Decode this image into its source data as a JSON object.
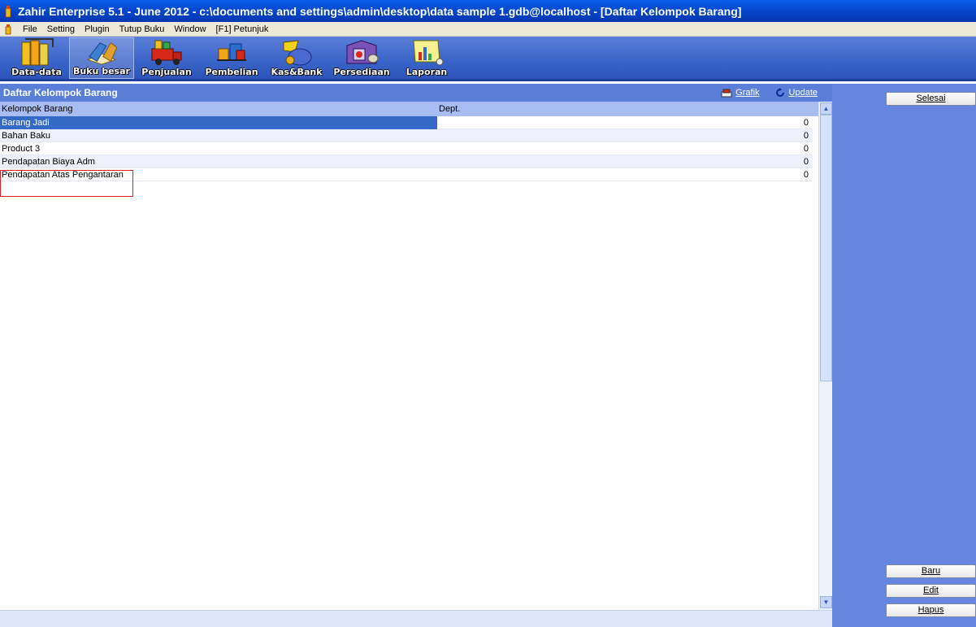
{
  "window": {
    "title": "Zahir Enterprise 5.1 - June 2012 - c:\\documents and settings\\admin\\desktop\\data sample 1.gdb@localhost - [Daftar Kelompok Barang]"
  },
  "menu": [
    "File",
    "Setting",
    "Plugin",
    "Tutup Buku",
    "Window",
    "[F1] Petunjuk"
  ],
  "toolbar": [
    {
      "label": "Data-data",
      "icon": "binders-icon"
    },
    {
      "label": "Buku besar",
      "icon": "ledger-book-icon",
      "active": true
    },
    {
      "label": "Penjualan",
      "icon": "sales-truck-icon"
    },
    {
      "label": "Pembelian",
      "icon": "purchase-gifts-icon"
    },
    {
      "label": "Kas&Bank",
      "icon": "cash-bag-icon"
    },
    {
      "label": "Persediaan",
      "icon": "warehouse-icon"
    },
    {
      "label": "Laporan",
      "icon": "report-chart-icon"
    }
  ],
  "content": {
    "title": "Daftar Kelompok Barang",
    "actions": {
      "grafik": "Grafik",
      "update": "Update"
    },
    "columns": {
      "kelompok": "Kelompok Barang",
      "dept": "Dept."
    },
    "rows": [
      {
        "kelompok": "Barang Jadi",
        "dept": "0",
        "selected": true
      },
      {
        "kelompok": "Bahan Baku",
        "dept": "0"
      },
      {
        "kelompok": "Product 3",
        "dept": "0"
      },
      {
        "kelompok": "Pendapatan Biaya Adm",
        "dept": "0"
      },
      {
        "kelompok": "Pendapatan Atas Pengantaran",
        "dept": "0"
      }
    ]
  },
  "side": {
    "selesai": "Selesai",
    "baru": "Baru",
    "edit": "Edit",
    "hapus": "Hapus"
  },
  "colors": {
    "titlebar": "#0443c8",
    "toolbar": "#3a63c8",
    "panel": "#6585e0",
    "selection": "#3569c8",
    "highlight_border": "#e02020"
  }
}
